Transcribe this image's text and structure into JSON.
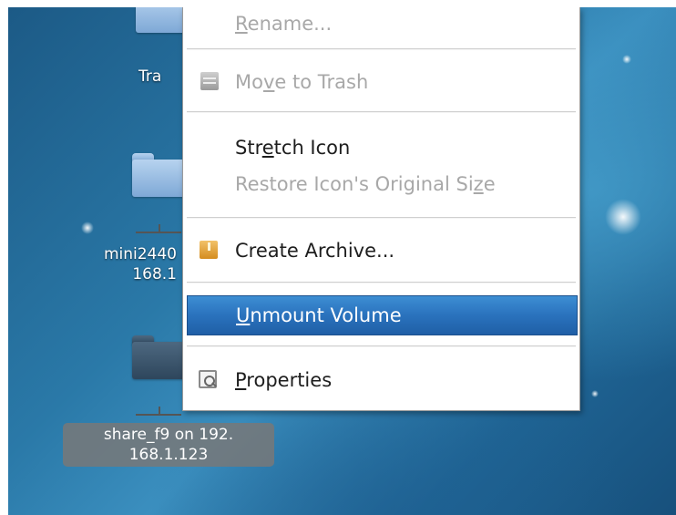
{
  "desktop": {
    "icons": [
      {
        "label": "Tra",
        "kind": "folder"
      },
      {
        "label_lines": [
          "mini2440",
          "168.1"
        ],
        "kind": "network-share"
      },
      {
        "label_lines": [
          "share_f9 on 192.",
          "168.1.123"
        ],
        "kind": "network-share",
        "selected": true
      }
    ]
  },
  "context_menu": {
    "items": [
      {
        "id": "rename",
        "label": "Rename...",
        "mnemonic": "R",
        "enabled": false
      },
      {
        "id": "move_to_trash",
        "label": "Move to Trash",
        "mnemonic": "v",
        "enabled": false,
        "icon": "trash-icon"
      },
      {
        "id": "stretch_icon",
        "label": "Stretch Icon",
        "mnemonic": "e",
        "enabled": true
      },
      {
        "id": "restore_icon",
        "label": "Restore Icon's Original Size",
        "mnemonic": "z",
        "enabled": false
      },
      {
        "id": "create_archive",
        "label": "Create Archive...",
        "enabled": true,
        "icon": "archive-icon"
      },
      {
        "id": "unmount_volume",
        "label": "Unmount Volume",
        "mnemonic": "U",
        "enabled": true,
        "highlighted": true
      },
      {
        "id": "properties",
        "label": "Properties",
        "mnemonic": "P",
        "enabled": true,
        "icon": "properties-icon"
      }
    ]
  },
  "colors": {
    "menu_highlight": "#2a72bd",
    "menu_text": "#1e1e1e",
    "menu_disabled_text": "#a8a8a8",
    "desktop_blue": "#2a79a8"
  }
}
